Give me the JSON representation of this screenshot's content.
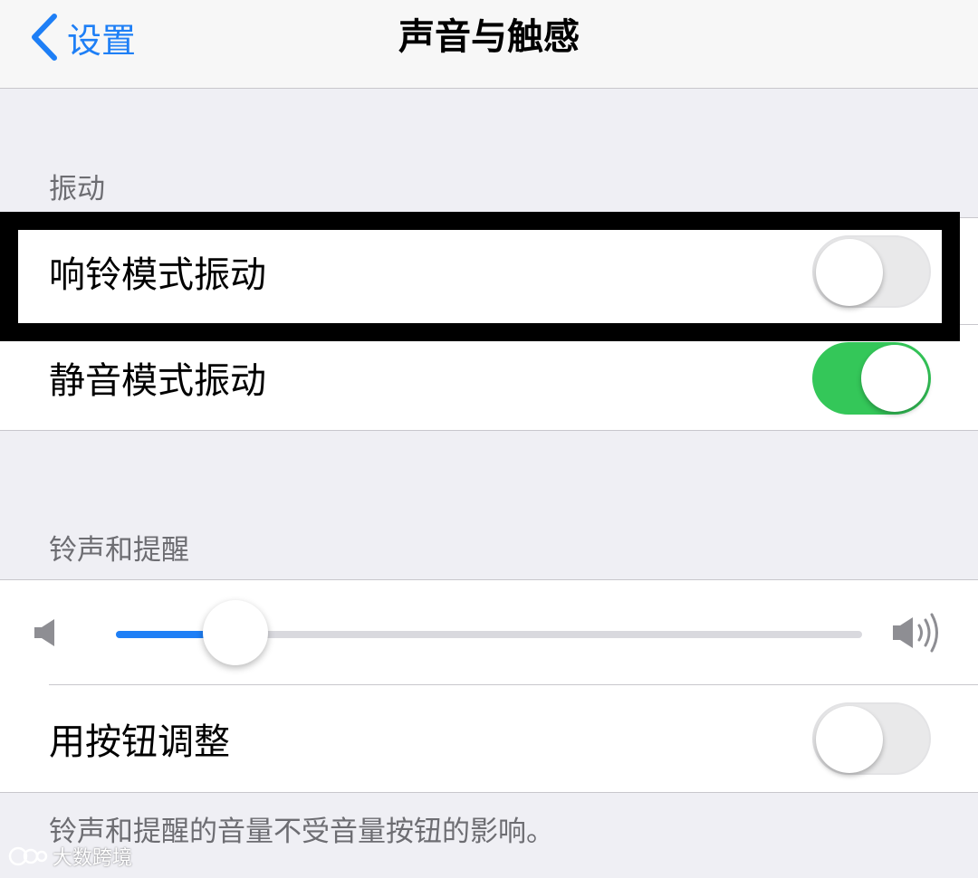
{
  "nav": {
    "back_label": "设置",
    "title": "声音与触感"
  },
  "vibration": {
    "header": "振动",
    "rows": [
      {
        "label": "响铃模式振动",
        "toggle": "off"
      },
      {
        "label": "静音模式振动",
        "toggle": "on"
      }
    ]
  },
  "ringer": {
    "header": "铃声和提醒",
    "volume_level": 0.16,
    "volume_low_icon": "speaker-low-icon",
    "volume_high_icon": "speaker-high-icon",
    "adjust_row": {
      "label": "用按钮调整",
      "toggle": "off"
    },
    "footer": "铃声和提醒的音量不受音量按钮的影响。"
  },
  "watermark": "大数跨境",
  "colors": {
    "accent": "#1e7ff6",
    "toggle_on": "#34c759",
    "toggle_off": "#e9e9ea",
    "highlight_border": "#000000"
  }
}
